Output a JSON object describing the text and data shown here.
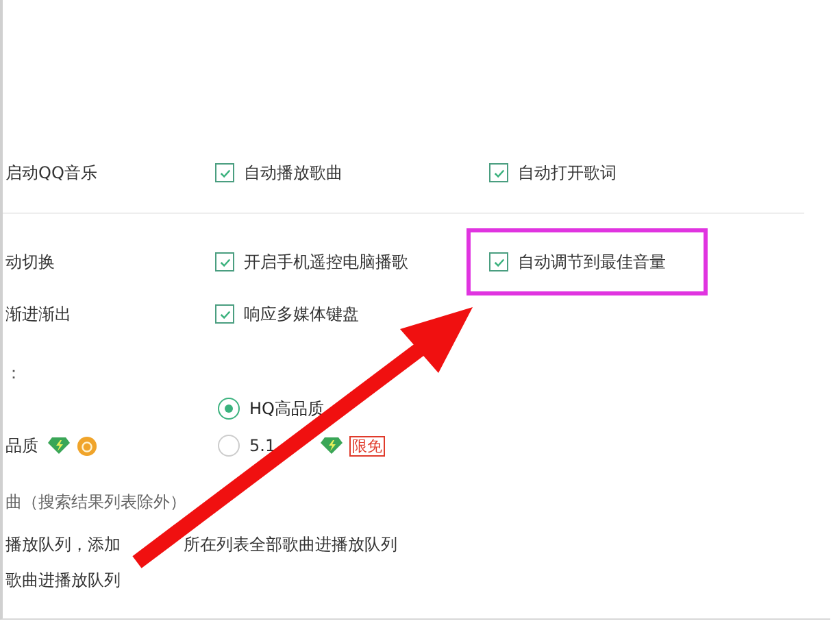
{
  "options": [
    {
      "label": "启动QQ音乐"
    },
    {
      "label": "自动播放歌曲",
      "checked": true
    },
    {
      "label": "自动打开歌词",
      "checked": true
    }
  ],
  "options2": [
    {
      "label": "动切换"
    },
    {
      "label": "开启手机遥控电脑播歌",
      "checked": true
    },
    {
      "label": "自动调节到最佳音量",
      "checked": true
    },
    {
      "label": "渐进渐出"
    },
    {
      "label": "响应多媒体键盘",
      "checked": true
    }
  ],
  "quality": {
    "heading": "：",
    "choices": [
      {
        "kind": "radio",
        "label": "HQ高品质",
        "selected": true
      },
      {
        "kind": "text",
        "label": "品质",
        "badges": [
          {
            "kind": "diamond"
          },
          {
            "kind": "coin"
          }
        ]
      },
      {
        "kind": "radio",
        "label": "5.1",
        "selected": false,
        "badges": [
          {
            "kind": "diamond"
          },
          {
            "kind": "tag",
            "text": "限免"
          }
        ]
      }
    ]
  },
  "double_click": {
    "heading": "曲（搜索结果列表除外）",
    "lines": [
      [
        "播放队列，添加",
        "所在列表全部歌曲进播放队列"
      ],
      [
        "歌曲进播放队列"
      ]
    ]
  }
}
